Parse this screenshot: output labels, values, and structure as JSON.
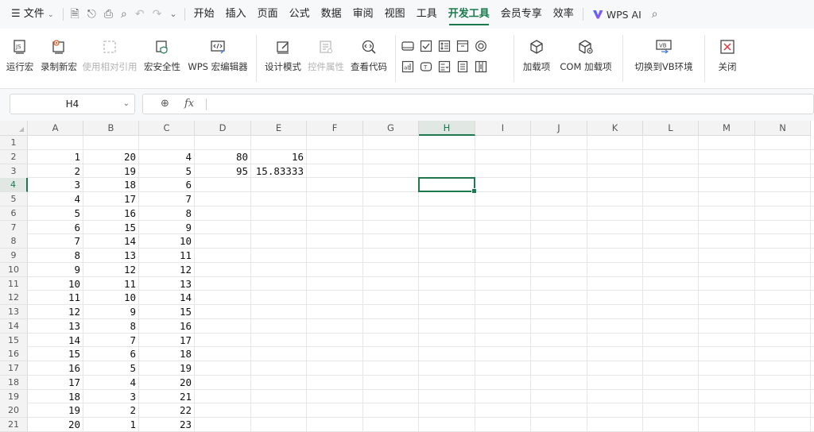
{
  "menubar": {
    "menu_icon": "☰",
    "file": "文件",
    "tabs": [
      "开始",
      "插入",
      "页面",
      "公式",
      "数据",
      "审阅",
      "视图",
      "工具",
      "开发工具",
      "会员专享",
      "效率"
    ],
    "active_tab": "开发工具",
    "ai_label": "WPS AI"
  },
  "ribbon": {
    "run_macro": "运行宏",
    "record_macro": "录制新宏",
    "relative_ref": "使用相对引用",
    "macro_security": "宏安全性",
    "macro_editor": "WPS 宏编辑器",
    "design_mode": "设计模式",
    "control_props": "控件属性",
    "view_code": "查看代码",
    "addins": "加载项",
    "com_addins": "COM 加载项",
    "switch_vb": "切换到VB环境",
    "close": "关闭"
  },
  "formula_bar": {
    "name_box": "H4",
    "fx_label": "fx",
    "formula": ""
  },
  "sheet": {
    "columns": [
      "A",
      "B",
      "C",
      "D",
      "E",
      "F",
      "G",
      "H",
      "I",
      "J",
      "K",
      "L",
      "M",
      "N"
    ],
    "selected_column": "H",
    "rows": [
      "1",
      "2",
      "3",
      "4",
      "5",
      "6",
      "7",
      "8",
      "9",
      "10",
      "11",
      "12",
      "13",
      "14",
      "15",
      "16",
      "17",
      "18",
      "19",
      "20",
      "21"
    ],
    "selected_row": "4",
    "col_a": [
      "",
      "1",
      "2",
      "3",
      "4",
      "5",
      "6",
      "7",
      "8",
      "9",
      "10",
      "11",
      "12",
      "13",
      "14",
      "15",
      "16",
      "17",
      "18",
      "19",
      "20"
    ],
    "col_b": [
      "",
      "20",
      "19",
      "18",
      "17",
      "16",
      "15",
      "14",
      "13",
      "12",
      "11",
      "10",
      "9",
      "8",
      "7",
      "6",
      "5",
      "4",
      "3",
      "2",
      "1"
    ],
    "col_c": [
      "",
      "4",
      "5",
      "6",
      "7",
      "8",
      "9",
      "10",
      "11",
      "12",
      "13",
      "14",
      "15",
      "16",
      "17",
      "18",
      "19",
      "20",
      "21",
      "22",
      "23"
    ],
    "col_d": [
      "",
      "80",
      "95"
    ],
    "col_e": [
      "",
      "16",
      "15.83333"
    ]
  }
}
